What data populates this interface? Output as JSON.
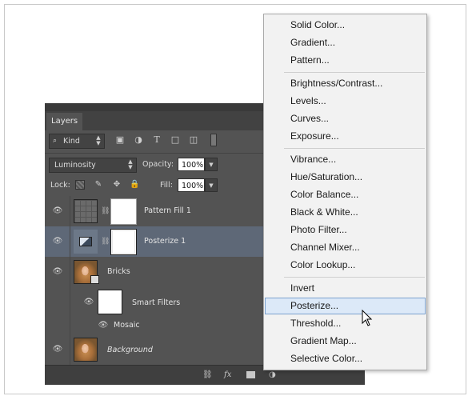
{
  "layers_panel": {
    "tab_label": "Layers",
    "kind_filter": {
      "icon": "search-icon",
      "value": "Kind"
    },
    "blend_mode": "Luminosity",
    "opacity": {
      "label": "Opacity:",
      "value": "100%"
    },
    "fill": {
      "label": "Fill:",
      "value": "100%"
    },
    "lock_label": "Lock:",
    "layers": [
      {
        "name": "Pattern Fill 1",
        "thumb": "pattern",
        "has_mask": true,
        "visible": true,
        "selected": false
      },
      {
        "name": "Posterize 1",
        "thumb": "posterize",
        "has_mask": true,
        "visible": true,
        "selected": true
      },
      {
        "name": "Bricks",
        "thumb": "photo",
        "has_mask": false,
        "visible": true,
        "selected": false
      },
      {
        "name": "Smart Filters",
        "thumb": "filter-mask",
        "visible": true,
        "sublayer": true
      },
      {
        "name": "Mosaic",
        "visible": true,
        "sublayer": true
      },
      {
        "name": "Background",
        "thumb": "photo",
        "visible": true,
        "selected": false,
        "italic": true
      }
    ]
  },
  "adjustment_menu": {
    "groups": [
      [
        "Solid Color...",
        "Gradient...",
        "Pattern..."
      ],
      [
        "Brightness/Contrast...",
        "Levels...",
        "Curves...",
        "Exposure..."
      ],
      [
        "Vibrance...",
        "Hue/Saturation...",
        "Color Balance...",
        "Black & White...",
        "Photo Filter...",
        "Channel Mixer...",
        "Color Lookup..."
      ],
      [
        "Invert",
        "Posterize...",
        "Threshold...",
        "Gradient Map...",
        "Selective Color..."
      ]
    ],
    "highlighted_item": "Posterize...",
    "highlight_color": "#dce9f8",
    "highlight_border": "#7da2ce"
  },
  "colors": {
    "panel_bg": "#535353",
    "selected_layer_bg": "#5e6877",
    "menu_bg": "#f2f2f2"
  }
}
